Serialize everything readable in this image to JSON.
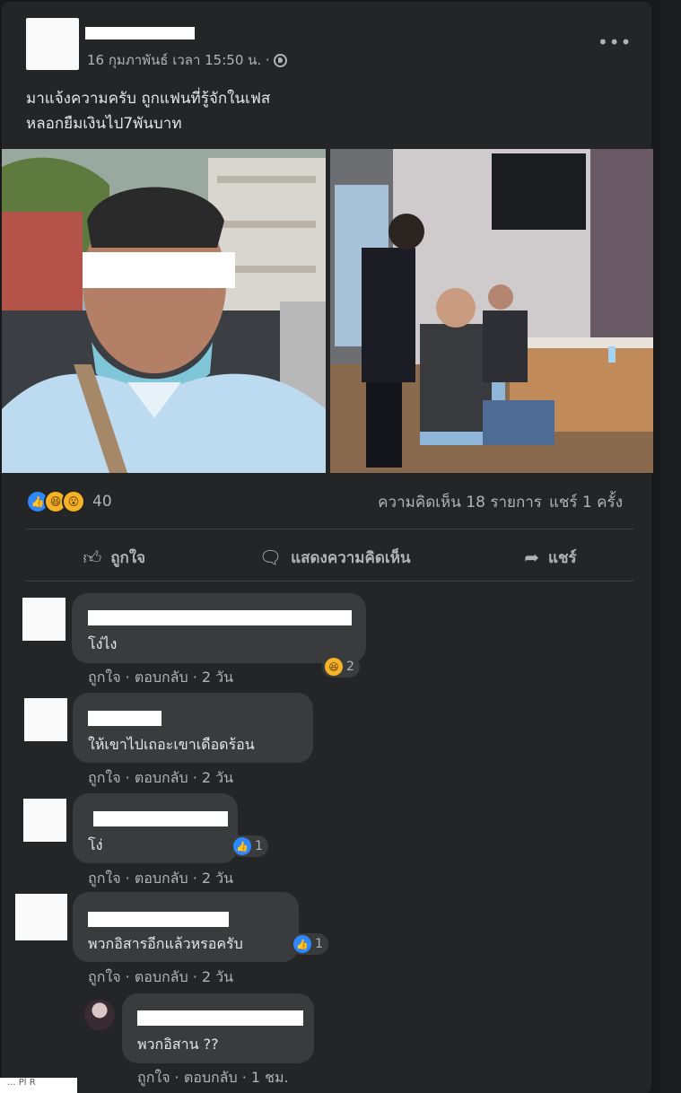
{
  "post": {
    "timestamp": "16 กุมภาพันธ์ เวลา 15:50 น. ·",
    "audience_icon": "globe-icon",
    "more_label": "•••",
    "text_line1": "มาแจ้งความครับ ถูกแฟนที่รู้จักในเฟส",
    "text_line2": "หลอกยืมเงินไป7พันบาท"
  },
  "reactions": {
    "icons": [
      "like-icon",
      "haha-icon",
      "wow-icon"
    ],
    "count": "40",
    "comments": "ความคิดเห็น 18 รายการ",
    "shares": "แชร์ 1 ครั้ง"
  },
  "actions": {
    "like": "ถูกใจ",
    "comment": "แสดงความคิดเห็น",
    "share": "แชร์"
  },
  "comments": [
    {
      "text": "โง่ไง",
      "meta": "ถูกใจ · ตอบกลับ · 2 วัน",
      "reaction_count": "2",
      "reaction_icon": "haha-icon"
    },
    {
      "text": "ให้เขาไปเถอะเขาเดือดร้อน",
      "meta": "ถูกใจ · ตอบกลับ · 2 วัน"
    },
    {
      "text": "โง่",
      "meta": "ถูกใจ · ตอบกลับ · 2 วัน",
      "reaction_count": "1",
      "reaction_icon": "like-icon"
    },
    {
      "text": "พวกอิสารอีกแล้วหรอครับ",
      "meta": "ถูกใจ · ตอบกลับ · 2 วัน",
      "reaction_count": "1",
      "reaction_icon": "like-icon"
    },
    {
      "text": "พวกอิสาน ??",
      "meta": "ถูกใจ · ตอบกลับ · 1 ชม."
    }
  ],
  "footer_tag": "... Pl R",
  "colors": {
    "background": "#18191a",
    "card": "#242526",
    "bubble": "#3a3b3c",
    "accent_like": "#2d88ff",
    "text_primary": "#e4e6eb",
    "text_secondary": "#b0b3b8"
  }
}
